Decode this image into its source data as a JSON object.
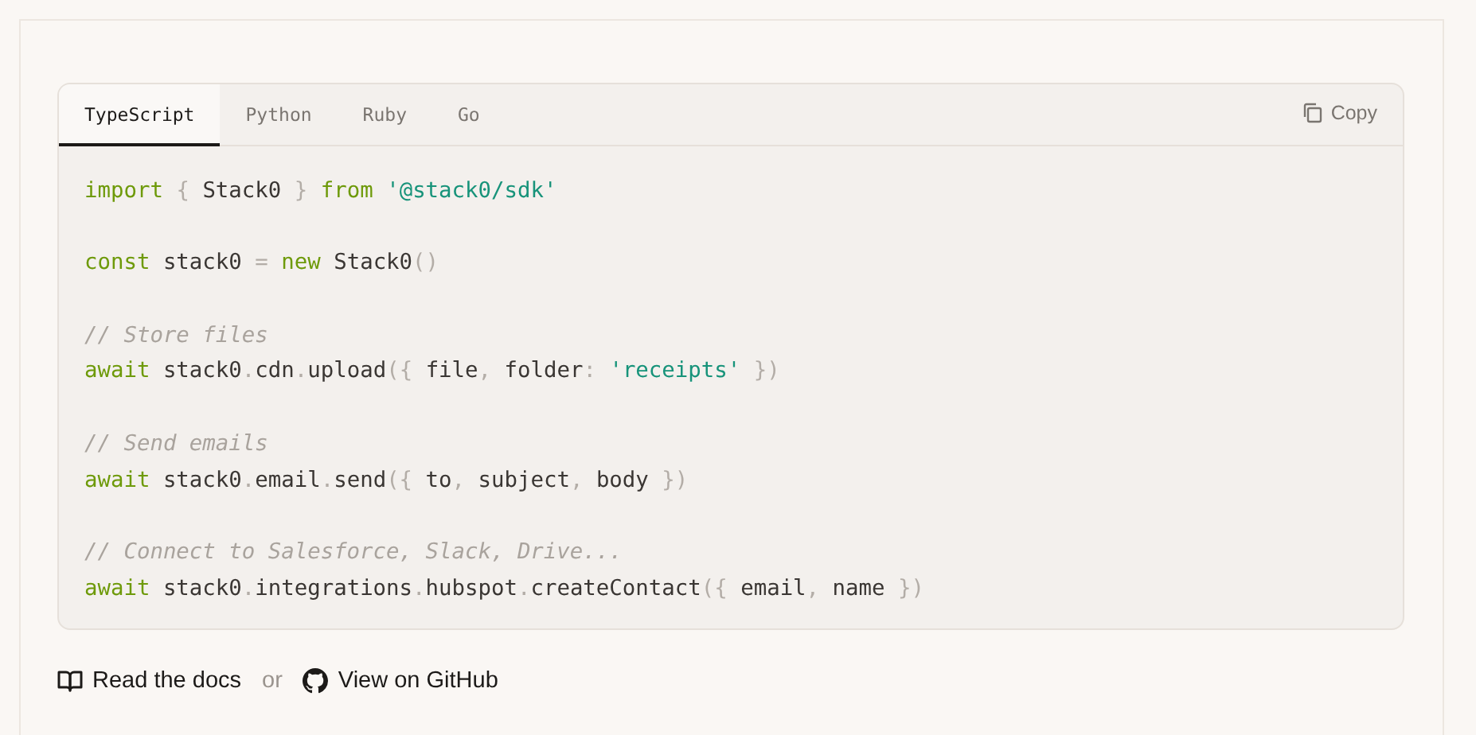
{
  "tabs": [
    {
      "label": "TypeScript",
      "selected": true
    },
    {
      "label": "Python",
      "selected": false
    },
    {
      "label": "Ruby",
      "selected": false
    },
    {
      "label": "Go",
      "selected": false
    }
  ],
  "copy_button": {
    "label": "Copy"
  },
  "code_lines": [
    {
      "kind": "code",
      "tokens": [
        {
          "kind": "keyword",
          "text": "import"
        },
        {
          "kind": "punct",
          "text": " { "
        },
        {
          "kind": "plain",
          "text": "Stack0"
        },
        {
          "kind": "punct",
          "text": " } "
        },
        {
          "kind": "keyword",
          "text": "from"
        },
        {
          "kind": "string",
          "text": " '@stack0/sdk'"
        }
      ]
    },
    {
      "kind": "blank"
    },
    {
      "kind": "code",
      "tokens": [
        {
          "kind": "keyword",
          "text": "const"
        },
        {
          "kind": "plain",
          "text": " stack0 "
        },
        {
          "kind": "punct",
          "text": "= "
        },
        {
          "kind": "keyword",
          "text": "new"
        },
        {
          "kind": "plain",
          "text": " Stack0"
        },
        {
          "kind": "punct",
          "text": "()"
        }
      ]
    },
    {
      "kind": "blank"
    },
    {
      "kind": "code",
      "tokens": [
        {
          "kind": "comment",
          "text": "// Store files"
        }
      ]
    },
    {
      "kind": "code",
      "tokens": [
        {
          "kind": "keyword",
          "text": "await"
        },
        {
          "kind": "plain",
          "text": " stack0"
        },
        {
          "kind": "punct",
          "text": "."
        },
        {
          "kind": "plain",
          "text": "cdn"
        },
        {
          "kind": "punct",
          "text": "."
        },
        {
          "kind": "plain",
          "text": "upload"
        },
        {
          "kind": "punct",
          "text": "({ "
        },
        {
          "kind": "plain",
          "text": "file"
        },
        {
          "kind": "punct",
          "text": ", "
        },
        {
          "kind": "plain",
          "text": "folder"
        },
        {
          "kind": "punct",
          "text": ": "
        },
        {
          "kind": "string",
          "text": "'receipts'"
        },
        {
          "kind": "punct",
          "text": " })"
        }
      ]
    },
    {
      "kind": "blank"
    },
    {
      "kind": "code",
      "tokens": [
        {
          "kind": "comment",
          "text": "// Send emails"
        }
      ]
    },
    {
      "kind": "code",
      "tokens": [
        {
          "kind": "keyword",
          "text": "await"
        },
        {
          "kind": "plain",
          "text": " stack0"
        },
        {
          "kind": "punct",
          "text": "."
        },
        {
          "kind": "plain",
          "text": "email"
        },
        {
          "kind": "punct",
          "text": "."
        },
        {
          "kind": "plain",
          "text": "send"
        },
        {
          "kind": "punct",
          "text": "({ "
        },
        {
          "kind": "plain",
          "text": "to"
        },
        {
          "kind": "punct",
          "text": ", "
        },
        {
          "kind": "plain",
          "text": "subject"
        },
        {
          "kind": "punct",
          "text": ", "
        },
        {
          "kind": "plain",
          "text": "body"
        },
        {
          "kind": "punct",
          "text": " })"
        }
      ]
    },
    {
      "kind": "blank"
    },
    {
      "kind": "code",
      "tokens": [
        {
          "kind": "comment",
          "text": "// Connect to Salesforce, Slack, Drive..."
        }
      ]
    },
    {
      "kind": "code",
      "tokens": [
        {
          "kind": "keyword",
          "text": "await"
        },
        {
          "kind": "plain",
          "text": " stack0"
        },
        {
          "kind": "punct",
          "text": "."
        },
        {
          "kind": "plain",
          "text": "integrations"
        },
        {
          "kind": "punct",
          "text": "."
        },
        {
          "kind": "plain",
          "text": "hubspot"
        },
        {
          "kind": "punct",
          "text": "."
        },
        {
          "kind": "plain",
          "text": "createContact"
        },
        {
          "kind": "punct",
          "text": "({ "
        },
        {
          "kind": "plain",
          "text": "email"
        },
        {
          "kind": "punct",
          "text": ", "
        },
        {
          "kind": "plain",
          "text": "name"
        },
        {
          "kind": "punct",
          "text": " })"
        }
      ]
    }
  ],
  "footer": {
    "docs_link": "Read the docs",
    "separator": "or",
    "github_link": "View on GitHub"
  }
}
